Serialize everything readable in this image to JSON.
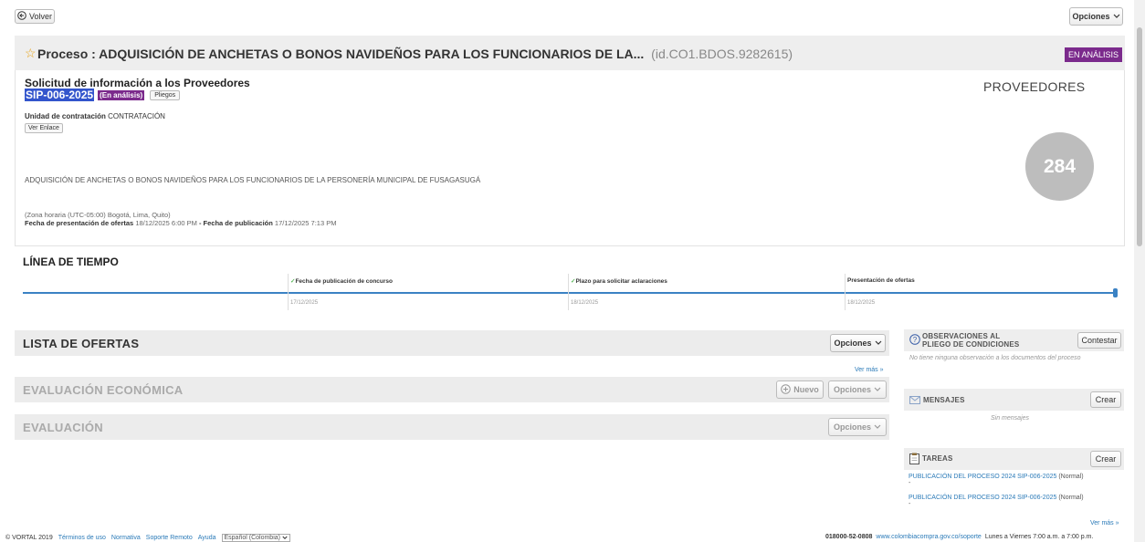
{
  "topbar": {
    "back_label": "Volver",
    "options_label": "Opciones"
  },
  "process": {
    "prefix": "Proceso : ",
    "title": "ADQUISICIÓN DE ANCHETAS O BONOS NAVIDEÑOS PARA LOS FUNCIONARIOS DE LA...",
    "id": "(id.CO1.BDOS.9282615)",
    "status_badge": "EN ANÁLISIS"
  },
  "request": {
    "heading": "Solicitud de información a los Proveedores",
    "code": "SIP-006-2025",
    "status": "(En análisis)",
    "pliegos_label": "Pliegos",
    "unit_label": "Unidad de contratación",
    "unit_value": "CONTRATACIÓN",
    "link_button": "Ver Enlace",
    "description": "ADQUISICIÓN DE ANCHETAS O BONOS NAVIDEÑOS PARA LOS FUNCIONARIOS DE LA PERSONERÍA MUNICIPAL DE FUSAGASUGÁ",
    "timezone": "(Zona horaria (UTC-05:00) Bogotá, Lima, Quito)",
    "offers_date_label": "Fecha de presentación de ofertas",
    "offers_date_value": "18/12/2025 6:00 PM",
    "separator": " - ",
    "publication_label": "Fecha de publicación",
    "publication_value": "17/12/2025 7:13 PM"
  },
  "providers": {
    "label": "PROVEEDORES",
    "count": "284"
  },
  "timeline": {
    "title": "LÍNEA DE TIEMPO",
    "milestones": [
      {
        "label": "Fecha de publicación de concurso",
        "date": "17/12/2025",
        "done": true
      },
      {
        "label": "Plazo para solicitar aclaraciones",
        "date": "18/12/2025",
        "done": true
      },
      {
        "label": "Presentación de ofertas",
        "date": "18/12/2025",
        "done": false
      }
    ]
  },
  "sections": {
    "offers_title": "LISTA DE OFERTAS",
    "offers_options": "Opciones",
    "see_more": "Ver más »",
    "economic_title": "EVALUACIÓN ECONÓMICA",
    "new_label": "Nuevo",
    "economic_options": "Opciones",
    "evaluation_title": "EVALUACIÓN",
    "evaluation_options": "Opciones"
  },
  "sidebar": {
    "observations_title": "OBSERVACIONES AL PLIEGO DE CONDICIONES",
    "observations_button": "Contestar",
    "observations_empty": "No tiene ninguna observación a los documentos del proceso",
    "messages_title": "MENSAJES",
    "messages_button": "Crear",
    "messages_empty": "Sin mensajes",
    "tasks_title": "TAREAS",
    "tasks_button": "Crear",
    "tasks": [
      {
        "label": "PUBLICACIÓN DEL PROCESO 2024 SIP-006-2025",
        "priority": "(Normal)",
        "dash": "-"
      },
      {
        "label": "PUBLICACIÓN DEL PROCESO 2024 SIP-006-2025",
        "priority": "(Normal)",
        "dash": "-"
      }
    ],
    "tasks_more": "Ver más »"
  },
  "footer": {
    "copyright": "© VORTAL 2019",
    "links": [
      "Términos de uso",
      "Normativa",
      "Soporte Remoto",
      "Ayuda"
    ],
    "language": "Español (Colombia)",
    "phone": "018000-52-0808",
    "support_url": "www.colombiacompra.gov.co/soporte",
    "hours": "Lunes a Viernes 7:00 a.m. a 7:00 p.m."
  },
  "colors": {
    "badge_purple": "#7b2a8c",
    "code_highlight": "#3355cc",
    "timeline_blue": "#3b82c4",
    "providers_circle": "#bdbdbd",
    "link_blue": "#2a7ab8"
  }
}
